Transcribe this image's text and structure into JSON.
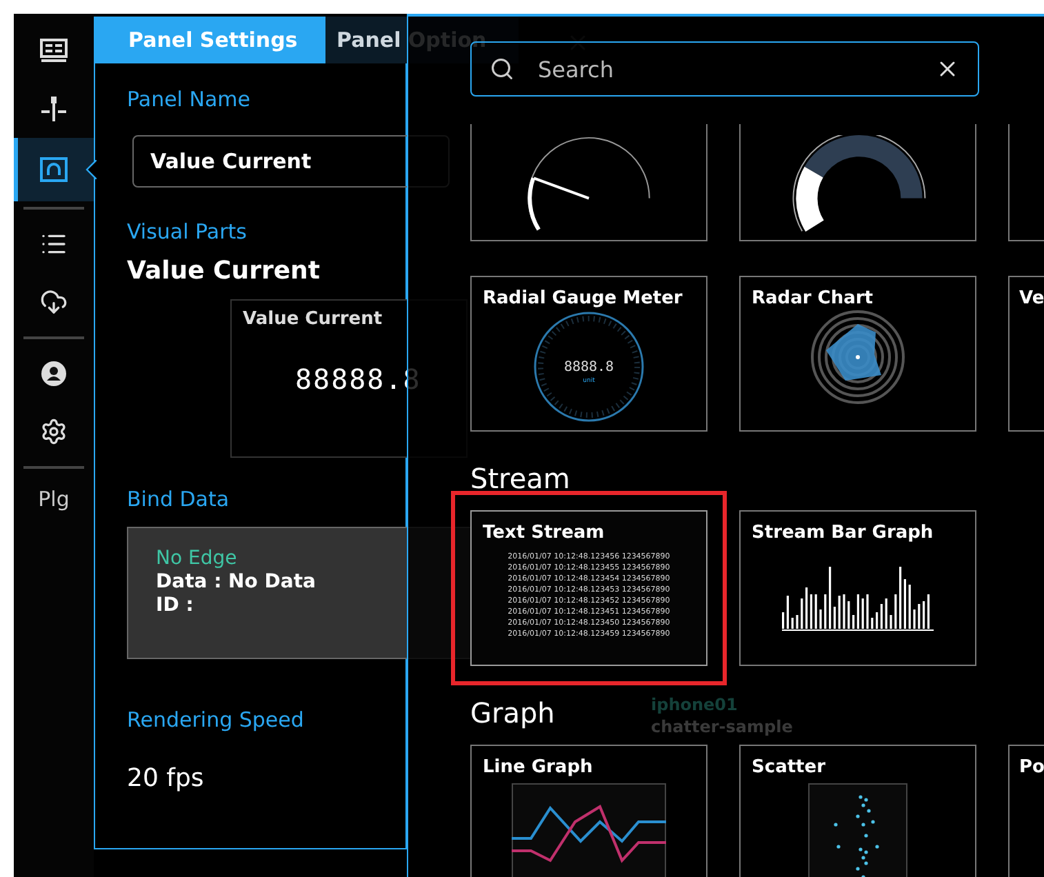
{
  "sidebar": {
    "items": [
      {
        "kind": "dashboard",
        "selected": false
      },
      {
        "kind": "network",
        "selected": false
      },
      {
        "kind": "gauge",
        "selected": true
      },
      {
        "kind": "divider"
      },
      {
        "kind": "list",
        "selected": false
      },
      {
        "kind": "cloud",
        "selected": false
      },
      {
        "kind": "divider"
      },
      {
        "kind": "user",
        "selected": false
      },
      {
        "kind": "settings",
        "selected": false
      },
      {
        "kind": "divider"
      },
      {
        "kind": "label",
        "label": "Plg",
        "selected": false
      }
    ]
  },
  "panel": {
    "tabs": [
      {
        "label": "Panel Settings",
        "selected": true
      },
      {
        "label": "Panel Option",
        "selected": false
      }
    ],
    "panel_name": {
      "label": "Panel Name",
      "value": "Value Current"
    },
    "visual_parts": {
      "label": "Visual Parts",
      "value": "Value Current",
      "preview_title": "Value Current",
      "preview_value": "88888.8"
    },
    "bind_data": {
      "label": "Bind Data",
      "edge": "No Edge",
      "data": "Data : No Data",
      "id": "ID :"
    },
    "rendering_speed": {
      "label": "Rendering Speed",
      "value": "20 fps"
    }
  },
  "background_texts": [
    "iphone01",
    "chatter-sample"
  ],
  "picker": {
    "search": {
      "placeholder": "Search"
    },
    "sections": [
      {
        "cards": [
          {
            "kind": "needle-gauge",
            "selected": false
          },
          {
            "kind": "arc-gauge",
            "selected": false
          },
          {
            "kind": "partial",
            "selected": false
          },
          {
            "kind": "radial-gauge",
            "title": "Radial Gauge Meter",
            "display": "8888.8",
            "unit": "unit",
            "selected": false
          },
          {
            "kind": "radar",
            "title": "Radar Chart",
            "selected": false
          },
          {
            "kind": "partial",
            "title": "Ve",
            "selected": false
          }
        ]
      },
      {
        "heading": "Stream",
        "cards": [
          {
            "kind": "text-stream",
            "title": "Text Stream",
            "lines": [
              "2016/01/07 10:12:48.123456 1234567890",
              "2016/01/07 10:12:48.123455 1234567890",
              "2016/01/07 10:12:48.123454 1234567890",
              "2016/01/07 10:12:48.123453 1234567890",
              "2016/01/07 10:12:48.123452 1234567890",
              "2016/01/07 10:12:48.123451 1234567890",
              "2016/01/07 10:12:48.123450 1234567890",
              "2016/01/07 10:12:48.123459 1234567890"
            ],
            "selected": true
          },
          {
            "kind": "bar-stream",
            "title": "Stream Bar Graph",
            "selected": false
          }
        ]
      },
      {
        "heading": "Graph",
        "cards": [
          {
            "kind": "line-graph",
            "title": "Line Graph",
            "selected": false
          },
          {
            "kind": "scatter",
            "title": "Scatter",
            "selected": false
          },
          {
            "kind": "partial",
            "title": "Po",
            "selected": false
          }
        ]
      }
    ]
  }
}
